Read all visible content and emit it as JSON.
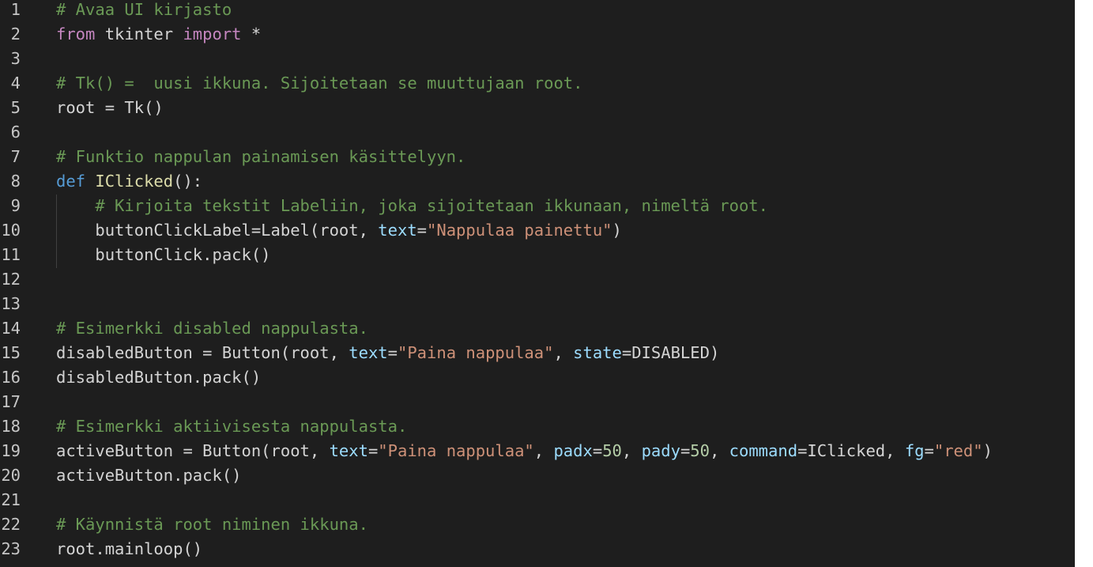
{
  "editor": {
    "lines": [
      {
        "n": "1",
        "tokens": [
          {
            "t": "# Avaa UI kirjasto",
            "c": "cm"
          }
        ]
      },
      {
        "n": "2",
        "tokens": [
          {
            "t": "from",
            "c": "kw"
          },
          {
            "t": " tkinter ",
            "c": ""
          },
          {
            "t": "import",
            "c": "kw"
          },
          {
            "t": " *",
            "c": ""
          }
        ]
      },
      {
        "n": "3",
        "tokens": []
      },
      {
        "n": "4",
        "tokens": [
          {
            "t": "# Tk() =  uusi ikkuna. Sijoitetaan se muuttujaan root.",
            "c": "cm"
          }
        ]
      },
      {
        "n": "5",
        "tokens": [
          {
            "t": "root = Tk()",
            "c": ""
          }
        ]
      },
      {
        "n": "6",
        "tokens": []
      },
      {
        "n": "7",
        "tokens": [
          {
            "t": "# Funktio nappulan painamisen käsittelyyn.",
            "c": "cm"
          }
        ]
      },
      {
        "n": "8",
        "tokens": [
          {
            "t": "def",
            "c": "df"
          },
          {
            "t": " ",
            "c": ""
          },
          {
            "t": "IClicked",
            "c": "fn"
          },
          {
            "t": "():",
            "c": ""
          }
        ]
      },
      {
        "n": "9",
        "tokens": [
          {
            "t": "    ",
            "c": ""
          },
          {
            "t": "# Kirjoita tekstit Labeliin, joka sijoitetaan ikkunaan, nimeltä root.",
            "c": "cm"
          }
        ]
      },
      {
        "n": "10",
        "tokens": [
          {
            "t": "    buttonClickLabel=Label(root, ",
            "c": ""
          },
          {
            "t": "text",
            "c": "pm"
          },
          {
            "t": "=",
            "c": ""
          },
          {
            "t": "\"Nappulaa painettu\"",
            "c": "st"
          },
          {
            "t": ")",
            "c": ""
          }
        ]
      },
      {
        "n": "11",
        "tokens": [
          {
            "t": "    buttonClick.pack()",
            "c": ""
          }
        ]
      },
      {
        "n": "12",
        "tokens": []
      },
      {
        "n": "13",
        "tokens": []
      },
      {
        "n": "14",
        "tokens": [
          {
            "t": "# Esimerkki disabled nappulasta.",
            "c": "cm"
          }
        ]
      },
      {
        "n": "15",
        "tokens": [
          {
            "t": "disabledButton = Button(root, ",
            "c": ""
          },
          {
            "t": "text",
            "c": "pm"
          },
          {
            "t": "=",
            "c": ""
          },
          {
            "t": "\"Paina nappulaa\"",
            "c": "st"
          },
          {
            "t": ", ",
            "c": ""
          },
          {
            "t": "state",
            "c": "pm"
          },
          {
            "t": "=DISABLED)",
            "c": ""
          }
        ]
      },
      {
        "n": "16",
        "tokens": [
          {
            "t": "disabledButton.pack()",
            "c": ""
          }
        ]
      },
      {
        "n": "17",
        "tokens": []
      },
      {
        "n": "18",
        "tokens": [
          {
            "t": "# Esimerkki aktiivisesta nappulasta.",
            "c": "cm"
          }
        ]
      },
      {
        "n": "19",
        "tokens": [
          {
            "t": "activeButton = Button(root, ",
            "c": ""
          },
          {
            "t": "text",
            "c": "pm"
          },
          {
            "t": "=",
            "c": ""
          },
          {
            "t": "\"Paina nappulaa\"",
            "c": "st"
          },
          {
            "t": ", ",
            "c": ""
          },
          {
            "t": "padx",
            "c": "pm"
          },
          {
            "t": "=",
            "c": ""
          },
          {
            "t": "50",
            "c": "nm"
          },
          {
            "t": ", ",
            "c": ""
          },
          {
            "t": "pady",
            "c": "pm"
          },
          {
            "t": "=",
            "c": ""
          },
          {
            "t": "50",
            "c": "nm"
          },
          {
            "t": ", ",
            "c": ""
          },
          {
            "t": "command",
            "c": "pm"
          },
          {
            "t": "=IClicked, ",
            "c": ""
          },
          {
            "t": "fg",
            "c": "pm"
          },
          {
            "t": "=",
            "c": ""
          },
          {
            "t": "\"red\"",
            "c": "st"
          },
          {
            "t": ")",
            "c": ""
          }
        ]
      },
      {
        "n": "20",
        "tokens": [
          {
            "t": "activeButton.pack()",
            "c": ""
          }
        ]
      },
      {
        "n": "21",
        "tokens": []
      },
      {
        "n": "22",
        "tokens": [
          {
            "t": "# Käynnistä root niminen ikkuna.",
            "c": "cm"
          }
        ]
      },
      {
        "n": "23",
        "tokens": [
          {
            "t": "root.mainloop()",
            "c": ""
          }
        ]
      }
    ]
  }
}
